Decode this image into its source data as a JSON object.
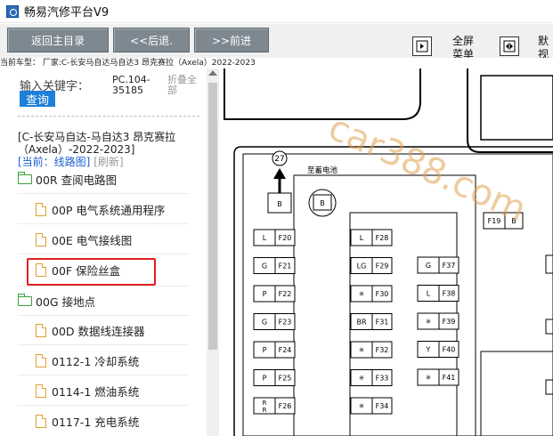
{
  "app": {
    "title": "畅易汽修平台V9"
  },
  "toolbar": {
    "home_label": "返回主目录",
    "back_label": "<<后退.",
    "forward_label": ">>前进",
    "fullscreen_label_line1": "全屏",
    "fullscreen_label_line2": "菜单",
    "default_view_line1": "默",
    "default_view_line2": "视"
  },
  "vehicle_line": "当前车型： 厂家:C-长安马自达马自达3 昂克赛拉（Axela）2022-2023",
  "search": {
    "label": "输入关键字：",
    "value_line1": "PC.104-",
    "value_line2": "35185",
    "fold_line1": "折叠全",
    "fold_line2": "部",
    "query_label": "查询"
  },
  "vehicle_path": {
    "line1": "[C-长安马自达-马自达3 昂克赛拉",
    "line2": "（Axela）-2022-2023]",
    "current_label": "[当前：线路图]",
    "refresh_label": "[刷新]"
  },
  "tree": [
    {
      "label": "00R 查阅电路图",
      "type": "folder"
    },
    {
      "label": "00P 电气系统通用程序",
      "type": "doc"
    },
    {
      "label": "00E 电气接线图",
      "type": "doc"
    },
    {
      "label": "00F 保险丝盒",
      "type": "doc"
    },
    {
      "label": "00G 接地点",
      "type": "folder"
    },
    {
      "label": "00D 数据线连接器",
      "type": "doc"
    },
    {
      "label": "0112-1 冷却系统",
      "type": "doc"
    },
    {
      "label": "0114-1 燃油系统",
      "type": "doc"
    },
    {
      "label": "0117-1 充电系统",
      "type": "doc"
    }
  ],
  "diagram": {
    "watermark": "car388.com",
    "connector_number": "27",
    "battery_label": "至蓄电池",
    "b_label": "B",
    "left_fuses": [
      {
        "color": "L",
        "id": "F20"
      },
      {
        "color": "G",
        "id": "F21"
      },
      {
        "color": "P",
        "id": "F22"
      },
      {
        "color": "G",
        "id": "F23"
      },
      {
        "color": "P",
        "id": "F24"
      },
      {
        "color": "P",
        "id": "F25"
      },
      {
        "color": "R",
        "color2": "R",
        "id": "F26"
      }
    ],
    "mid_fuses": [
      {
        "color": "L",
        "id": "F28"
      },
      {
        "color": "LG",
        "id": "F29"
      },
      {
        "color": "✳",
        "id": "F30"
      },
      {
        "color": "BR",
        "id": "F31"
      },
      {
        "color": "✳",
        "id": "F32"
      },
      {
        "color": "✳",
        "id": "F33"
      },
      {
        "color": "✳",
        "id": "F34"
      }
    ],
    "right_fuses": [
      {
        "color": "G",
        "id": "F37"
      },
      {
        "color": "L",
        "id": "F38"
      },
      {
        "color": "✳",
        "id": "F39"
      },
      {
        "color": "Y",
        "id": "F40"
      },
      {
        "color": "✳",
        "id": "F41"
      }
    ],
    "top_fuse": {
      "id": "F19",
      "color": "B"
    }
  }
}
